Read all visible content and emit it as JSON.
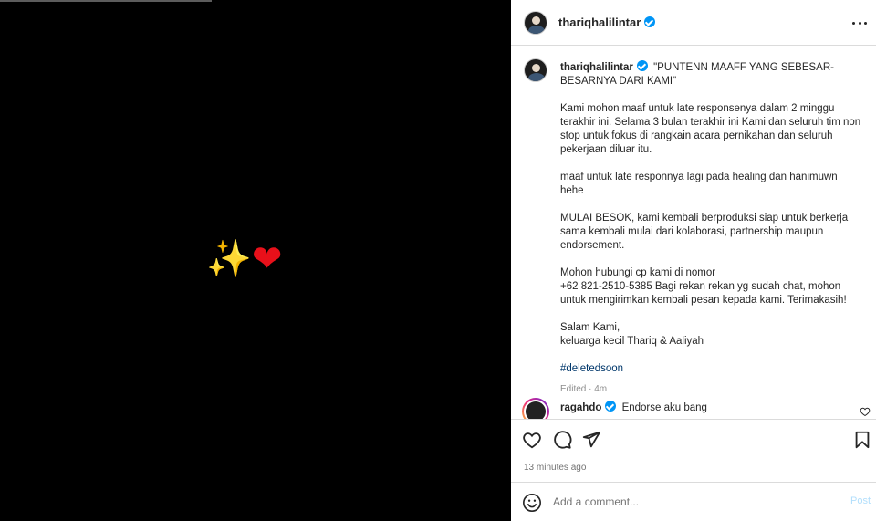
{
  "media": {
    "emoji_sparkles": "✨",
    "emoji_heart": "❤"
  },
  "header": {
    "username": "thariqhalilintar",
    "avatar_icon": "profile-avatar",
    "more_icon": "more-horizontal-icon"
  },
  "caption": {
    "username": "thariqhalilintar",
    "title": "\"PUNTENN MAAFF YANG SEBESAR-BESARNYA DARI KAMI\"",
    "paragraphs": [
      [
        "Kami mohon maaf untuk late responsenya dalam 2 minggu",
        "terakhir ini. Selama 3 bulan terakhir ini Kami dan seluruh tim non",
        "stop untuk fokus di rangkain acara pernikahan dan seluruh",
        "pekerjaan diluar itu."
      ],
      [
        "maaf untuk late responnya lagi pada healing dan hanimuwn",
        "hehe"
      ],
      [
        "MULAI BESOK, kami kembali berproduksi siap untuk berkerja",
        "sama kembali mulai dari kolaborasi, partnership maupun",
        "endorsement."
      ],
      [
        "Mohon hubungi cp kami di nomor",
        "+62 821-2510-5385 Bagi rekan rekan yg sudah chat, mohon",
        "untuk mengirimkan kembali pesan kepada kami. Terimakasih!"
      ],
      [
        "Salam Kami,",
        "keluarga kecil Thariq & Aaliyah"
      ]
    ],
    "hashtag": "#deletedsoon",
    "edited": "Edited · 4m"
  },
  "comment": {
    "username": "ragahdo",
    "text": "Endorse aku bang"
  },
  "actions": {
    "like_icon": "heart-outline-icon",
    "comment_icon": "comment-icon",
    "share_icon": "send-icon",
    "save_icon": "bookmark-icon",
    "time": "13 minutes ago"
  },
  "add_comment": {
    "placeholder": "Add a comment...",
    "post_label": "Post",
    "emoji_icon": "smiley-icon"
  },
  "colors": {
    "verified": "#0095f6",
    "hashtag": "#00376b",
    "post_disabled": "#b2dffc"
  }
}
